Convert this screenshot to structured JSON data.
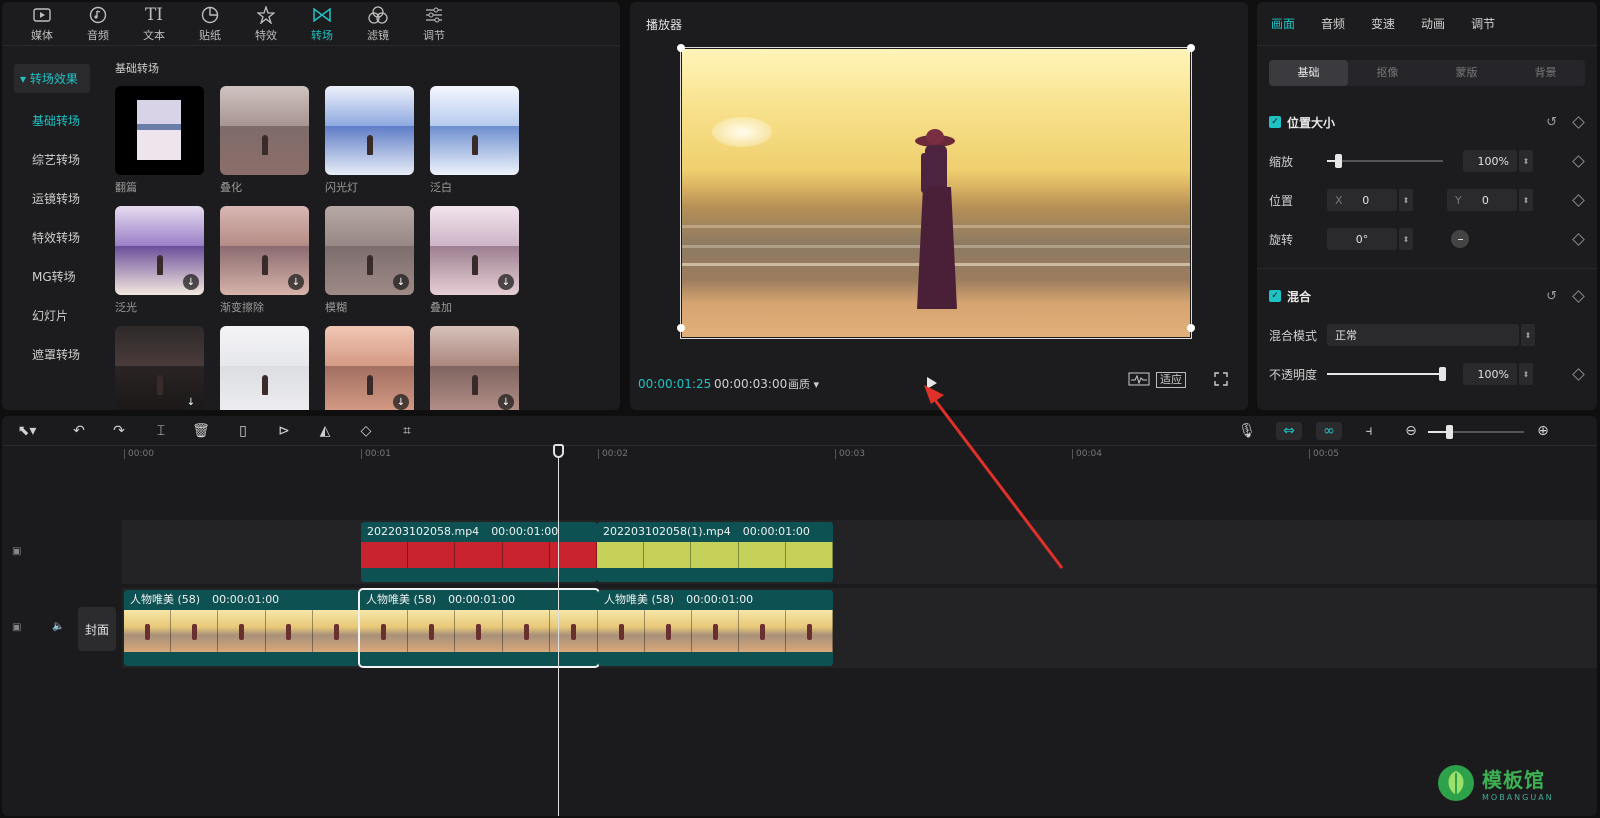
{
  "asset_panel": {
    "tabs": [
      {
        "label": "媒体",
        "icon": "media-icon"
      },
      {
        "label": "音频",
        "icon": "audio-icon"
      },
      {
        "label": "文本",
        "icon": "text-icon"
      },
      {
        "label": "贴纸",
        "icon": "sticker-icon"
      },
      {
        "label": "特效",
        "icon": "effects-icon"
      },
      {
        "label": "转场",
        "icon": "transition-icon",
        "active": true
      },
      {
        "label": "滤镜",
        "icon": "filter-icon"
      },
      {
        "label": "调节",
        "icon": "adjust-icon"
      }
    ],
    "category_header": "转场效果",
    "categories": [
      "基础转场",
      "综艺转场",
      "运镜转场",
      "特效转场",
      "MG转场",
      "幻灯片",
      "遮罩转场"
    ],
    "active_category": "基础转场",
    "grid_title": "基础转场",
    "items": [
      {
        "label": "翻篇",
        "download": false
      },
      {
        "label": "叠化",
        "download": false
      },
      {
        "label": "闪光灯",
        "download": false
      },
      {
        "label": "泛白",
        "download": false
      },
      {
        "label": "泛光",
        "download": true
      },
      {
        "label": "渐变擦除",
        "download": true
      },
      {
        "label": "模糊",
        "download": true
      },
      {
        "label": "叠加",
        "download": true
      },
      {
        "label": "",
        "download": true
      },
      {
        "label": "",
        "download": false
      },
      {
        "label": "",
        "download": true
      },
      {
        "label": "",
        "download": true
      }
    ]
  },
  "player": {
    "title": "播放器",
    "current_time": "00:00:01:25",
    "total_time": "00:00:03:00",
    "quality_label": "画质",
    "fit_label": "适应"
  },
  "inspector": {
    "tabs": [
      "画面",
      "音频",
      "变速",
      "动画",
      "调节"
    ],
    "active_tab": "画面",
    "sub_tabs": [
      "基础",
      "抠像",
      "蒙版",
      "背景"
    ],
    "position_size": {
      "title": "位置大小",
      "scale_label": "缩放",
      "scale_value": "100%",
      "scale_fraction": 0.1,
      "position_label": "位置",
      "x_label": "X",
      "x_value": "0",
      "y_label": "Y",
      "y_value": "0",
      "rotate_label": "旋转",
      "rotate_value": "0°"
    },
    "blend": {
      "title": "混合",
      "mode_label": "混合模式",
      "mode_value": "正常",
      "opacity_label": "不透明度",
      "opacity_value": "100%",
      "opacity_fraction": 1.0
    }
  },
  "timeline": {
    "ruler": [
      "00:00",
      "00:01",
      "00:02",
      "00:03",
      "00:04",
      "00:05"
    ],
    "cover_label": "封面",
    "overlay_clips": [
      {
        "name": "202203102058.mp4",
        "duration": "00:00:01:00",
        "color": "#c9232e"
      },
      {
        "name": "202203102058(1).mp4",
        "duration": "00:00:01:00",
        "color": "#c6d15a"
      }
    ],
    "main_clips": [
      {
        "name": "人物唯美 (58)",
        "duration": "00:00:01:00"
      },
      {
        "name": "人物唯美 (58)",
        "duration": "00:00:01:00",
        "selected": true
      },
      {
        "name": "人物唯美 (58)",
        "duration": "00:00:01:00"
      }
    ]
  },
  "watermark": {
    "cn": "模板馆",
    "en": "MOBANGUAN"
  },
  "colors": {
    "accent": "#1fc2c4",
    "panel": "#1c1c1e",
    "clip_teal": "#0d5153",
    "arrow": "#e0302a"
  }
}
